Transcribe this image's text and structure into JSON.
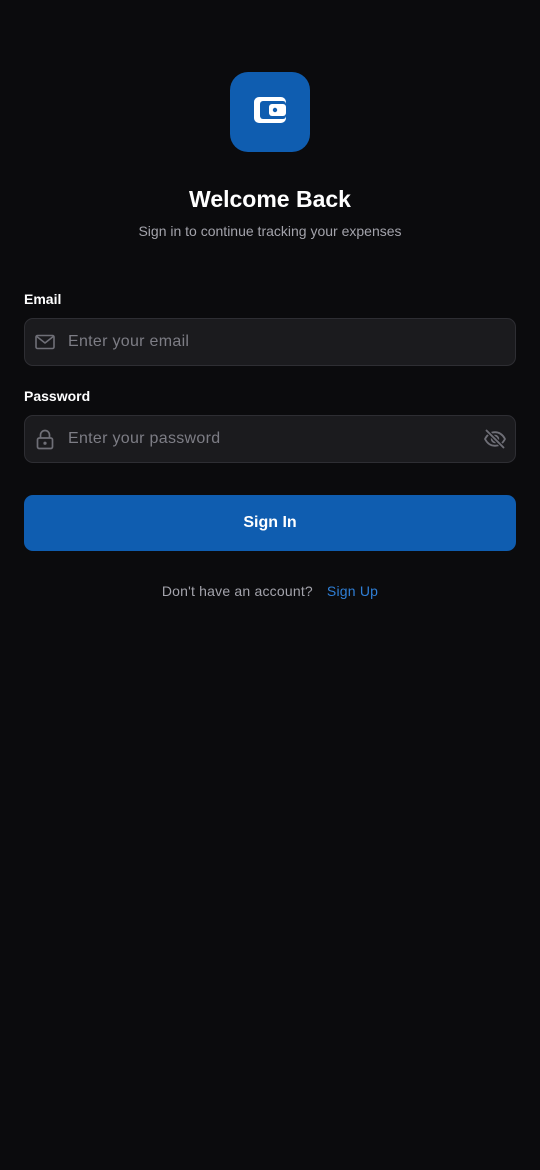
{
  "header": {
    "logo_icon": "wallet-icon",
    "title": "Welcome Back",
    "subtitle": "Sign in to continue tracking your expenses"
  },
  "form": {
    "email": {
      "label": "Email",
      "value": "",
      "placeholder": "Enter your email",
      "icon": "mail-icon"
    },
    "password": {
      "label": "Password",
      "value": "",
      "placeholder": "Enter your password",
      "icon": "lock-icon",
      "toggle_icon": "eye-off-icon"
    },
    "submit_label": "Sign In"
  },
  "footer": {
    "prompt": "Don't have an account?",
    "link_label": "Sign Up"
  },
  "colors": {
    "background": "#0b0b0d",
    "accent": "#0f5db0",
    "link": "#2f7fd6",
    "field_background": "#1b1b1e",
    "muted_text": "#a3a3ab"
  }
}
